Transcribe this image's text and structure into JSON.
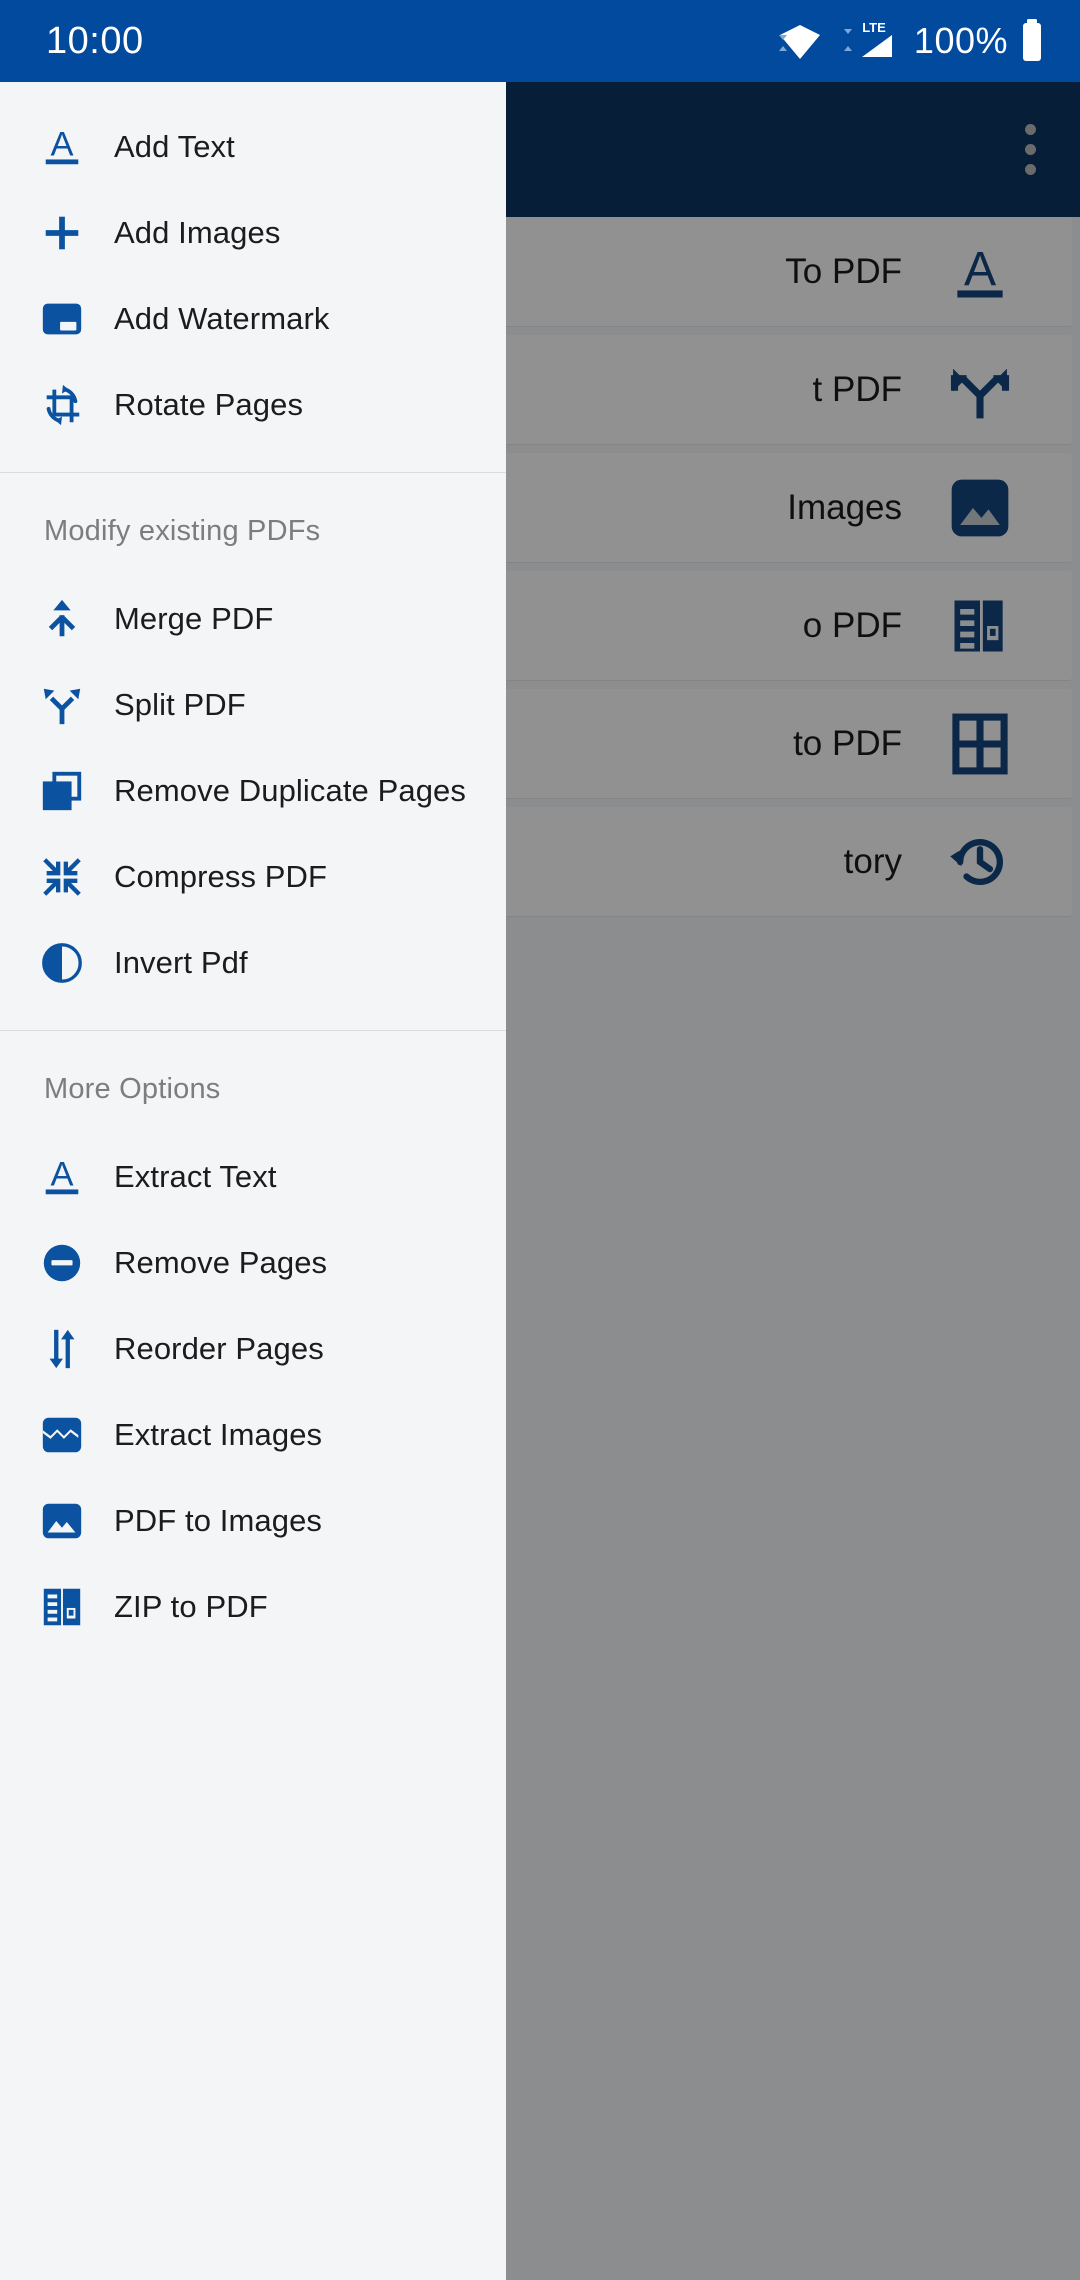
{
  "status_bar": {
    "time": "10:00",
    "battery_text": "100%",
    "network_label": "LTE",
    "icons": [
      "wifi-icon",
      "lte-signal-icon",
      "battery-icon"
    ],
    "background_color": "#014a9e"
  },
  "app_background": {
    "appbar": {
      "overflow_icon": "more-vert-icon",
      "background_color": "#0d3463"
    },
    "cards": [
      {
        "label": "To PDF",
        "icon": "text-format-icon"
      },
      {
        "label": "t PDF",
        "icon": "call-split-icon"
      },
      {
        "label": "Images",
        "icon": "image-icon"
      },
      {
        "label": "o PDF",
        "icon": "zip-icon"
      },
      {
        "label": "to PDF",
        "icon": "grid-four-icon"
      },
      {
        "label": "tory",
        "icon": "history-icon"
      }
    ]
  },
  "drawer": {
    "accent_color": "#0b52a0",
    "background_color": "#f4f5f7",
    "groups": [
      {
        "header": null,
        "items": [
          {
            "label": "Add Text",
            "icon": "text-format-icon"
          },
          {
            "label": "Add Images",
            "icon": "plus-icon"
          },
          {
            "label": "Add Watermark",
            "icon": "watermark-icon"
          },
          {
            "label": "Rotate Pages",
            "icon": "crop-rotate-icon"
          }
        ]
      },
      {
        "header": "Modify existing PDFs",
        "items": [
          {
            "label": "Merge PDF",
            "icon": "call-merge-icon"
          },
          {
            "label": "Split PDF",
            "icon": "call-split-icon"
          },
          {
            "label": "Remove Duplicate Pages",
            "icon": "copy-icon"
          },
          {
            "label": "Compress PDF",
            "icon": "compress-icon"
          },
          {
            "label": "Invert Pdf",
            "icon": "contrast-icon"
          }
        ]
      },
      {
        "header": "More Options",
        "items": [
          {
            "label": "Extract Text",
            "icon": "text-format-icon"
          },
          {
            "label": "Remove Pages",
            "icon": "remove-circle-icon"
          },
          {
            "label": "Reorder Pages",
            "icon": "swap-vert-icon"
          },
          {
            "label": "Extract Images",
            "icon": "broken-image-icon"
          },
          {
            "label": "PDF to Images",
            "icon": "image-icon"
          },
          {
            "label": "ZIP to PDF",
            "icon": "zip-icon"
          }
        ]
      }
    ]
  }
}
